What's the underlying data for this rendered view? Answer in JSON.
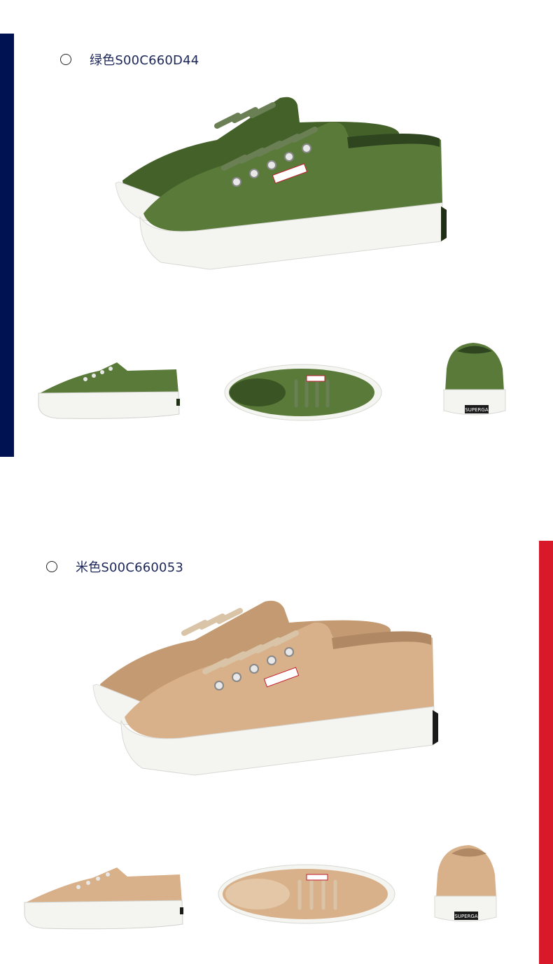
{
  "variants": [
    {
      "label": "绿色S00C660D44",
      "upper_color": "#5a7a3a",
      "upper_shadow": "#44612a",
      "lace_color": "#6b7f55",
      "sole_color": "#f4f4f0",
      "accent_bar_color": "#001252",
      "brand_tag": "SUPERGA"
    },
    {
      "label": "米色S00C660053",
      "upper_color": "#d8b08a",
      "upper_shadow": "#c39a72",
      "lace_color": "#d9c4a8",
      "sole_color": "#f4f4f0",
      "accent_bar_color": "#d7192a",
      "brand_tag": "SUPERGA"
    }
  ]
}
